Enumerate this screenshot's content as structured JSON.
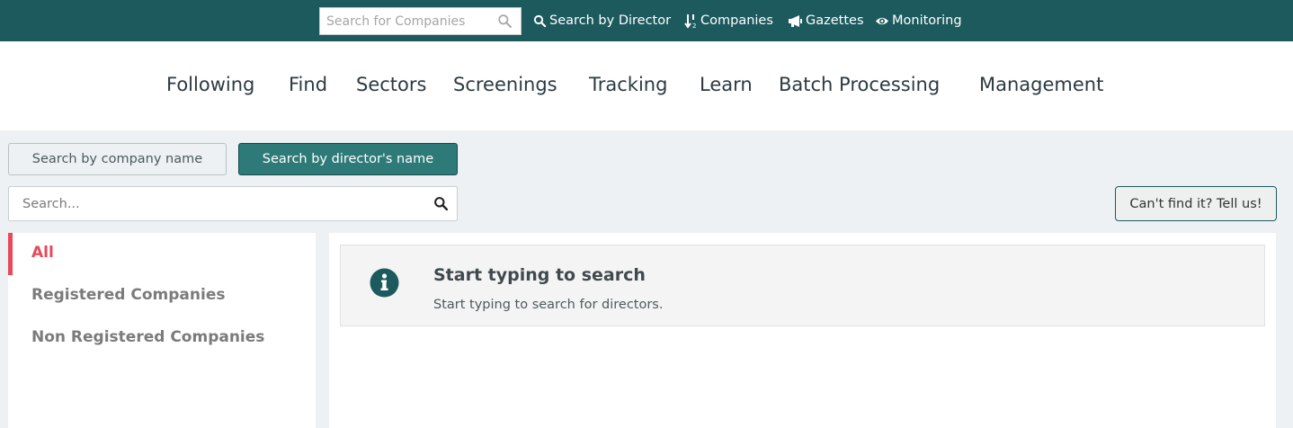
{
  "topbar": {
    "search": {
      "placeholder": "Search for Companies",
      "value": "",
      "icon": "search-icon"
    },
    "links": [
      {
        "label": "Search by Director",
        "icon": "search-icon"
      },
      {
        "label": "Companies",
        "icon": "sort-icon"
      },
      {
        "label": "Gazettes",
        "icon": "megaphone-icon"
      },
      {
        "label": "Monitoring",
        "icon": "eye-icon"
      }
    ]
  },
  "mainnav": {
    "items": [
      "Following",
      "Find",
      "Sectors",
      "Screenings",
      "Tracking",
      "Learn",
      "Batch Processing",
      "Management"
    ]
  },
  "toggle": {
    "company_label": "Search by company name",
    "director_label": "Search by director's name",
    "active": "director"
  },
  "search": {
    "placeholder": "Search...",
    "value": "",
    "icon": "search-icon"
  },
  "tell_us_label": "Can't find it? Tell us!",
  "sidebar": {
    "items": [
      {
        "label": "All",
        "active": true
      },
      {
        "label": "Registered Companies",
        "active": false
      },
      {
        "label": "Non Registered Companies",
        "active": false
      }
    ]
  },
  "info": {
    "icon": "info-icon",
    "title": "Start typing to search",
    "text": "Start typing to search for directors."
  },
  "colors": {
    "topbar": "#1d5a5e",
    "accent": "#2e7a78",
    "active_item": "#e8485a"
  }
}
